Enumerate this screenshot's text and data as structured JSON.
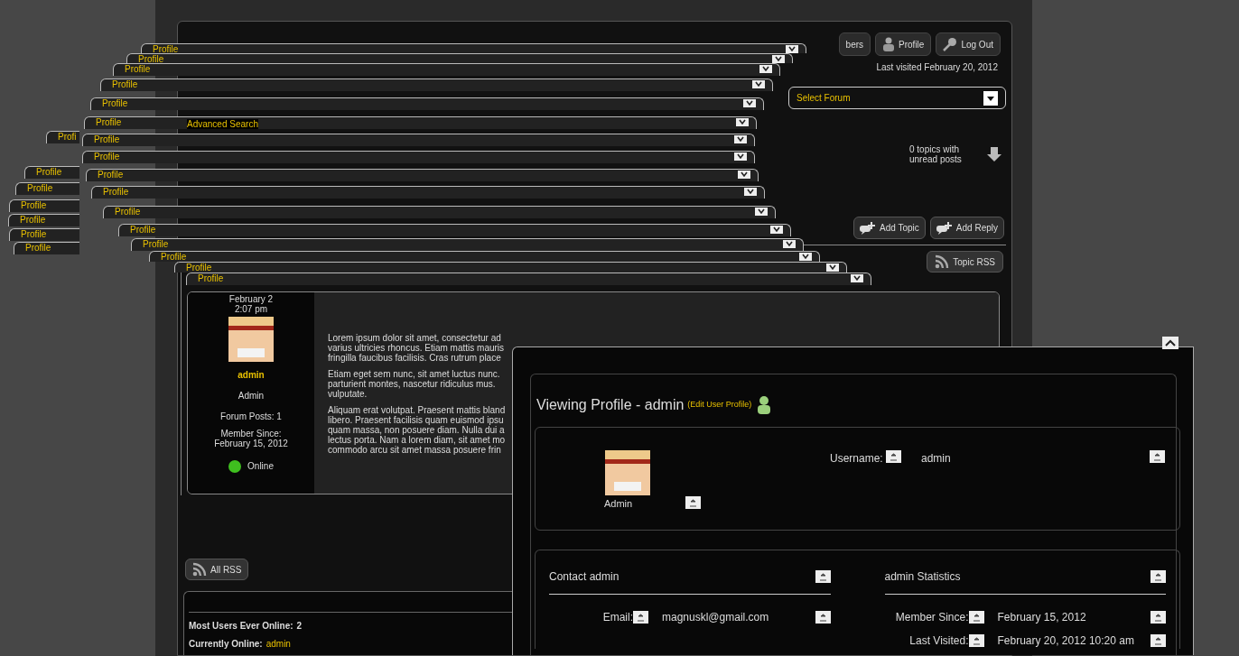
{
  "profile_tabs": [
    {
      "label": "Profile"
    },
    {
      "label": "Profile"
    },
    {
      "label": "Profile"
    },
    {
      "label": "Profile"
    },
    {
      "label": "Profile"
    },
    {
      "label": "Profile"
    },
    {
      "label": "Profile"
    },
    {
      "label": "Profile"
    },
    {
      "label": "Profile"
    },
    {
      "label": "Profile"
    },
    {
      "label": "Profile"
    },
    {
      "label": "Profile"
    },
    {
      "label": "Profile"
    },
    {
      "label": "Profile"
    },
    {
      "label": "Profile"
    },
    {
      "label": "Profile"
    },
    {
      "label": "Profi"
    },
    {
      "label": "Profile"
    },
    {
      "label": "Profile"
    },
    {
      "label": "Profile"
    },
    {
      "label": "Profile"
    },
    {
      "label": "Profile"
    },
    {
      "label": "Profile"
    }
  ],
  "header": {
    "buttons": [
      {
        "label": "bers"
      },
      {
        "label": "Profile"
      },
      {
        "label": "Log Out"
      }
    ],
    "last_visited": "Last visited February 20, 2012"
  },
  "search": {
    "advanced_link": "Advanced Search",
    "forum_select": "Select Forum"
  },
  "unread": "0 topics with unread posts",
  "topic_buttons": [
    {
      "label": "Add Topic"
    },
    {
      "label": "Add Reply"
    }
  ],
  "topic_rss": "Topic RSS",
  "post": {
    "date": "February 2",
    "time": "2:07 pm",
    "author": "admin",
    "role": "Admin",
    "posts": "Forum Posts: 1",
    "member_since_label": "Member Since:",
    "member_since": "February 15, 2012",
    "online": true,
    "status": "Online",
    "paragraphs": [
      [
        "Lorem ipsum dolor sit amet, consectetur ad",
        "varius ultricies rhoncus. Etiam mattis mauris",
        "fringilla faucibus facilisis. Cras rutrum place"
      ],
      [
        "Etiam eget sem nunc, sit amet luctus nunc.",
        "parturient montes, nascetur ridiculus mus.",
        "vulputate."
      ],
      [
        "Aliquam erat volutpat. Praesent mattis bland",
        "libero. Praesent facilisis quam euismod ipsu",
        "quam massa, non posuere diam. Nulla dui a",
        "lectus porta. Nam a lorem diam, sit amet mo",
        "commodo arcu sit amet massa posuere frin"
      ]
    ]
  },
  "all_rss": "All RSS",
  "stats": [
    {
      "label": "Most Users Ever Online:",
      "value": "2",
      "kind": "plain"
    },
    {
      "label": "Currently Online:",
      "value": "admin",
      "kind": "user"
    }
  ],
  "profile": {
    "title": "Viewing Profile - admin",
    "edit_link": "(Edit User Profile)",
    "role": "Admin",
    "username_label": "Username:",
    "username": "admin",
    "contact_title": "Contact admin",
    "stats_title": "admin Statistics",
    "contact_rows": [
      {
        "label": "Email:",
        "value": "magnuskl@gmail.com"
      }
    ],
    "stat_rows": [
      {
        "label": "Member Since:",
        "value": "February 15, 2012"
      },
      {
        "label": "Last Visited:",
        "value": "February 20, 2012 10:20 am"
      }
    ]
  }
}
